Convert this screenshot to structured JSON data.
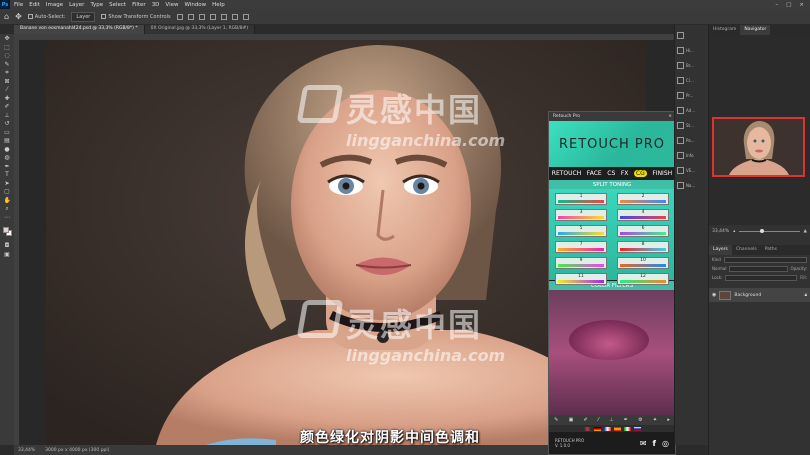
{
  "menubar": {
    "logo": "Ps",
    "items": [
      "File",
      "Edit",
      "Image",
      "Layer",
      "Type",
      "Select",
      "Filter",
      "3D",
      "View",
      "Window",
      "Help"
    ],
    "window_controls": [
      "–",
      "□",
      "×"
    ]
  },
  "options_bar": {
    "auto_select": "Auto-Select:",
    "layer_select": "Layer",
    "transform_controls": "Show Transform Controls"
  },
  "tabs": [
    {
      "label": "Banane von eosmanahl424.psd @ 33,3% (RGB/8*) *",
      "active": true
    },
    {
      "label": "0X Original.jpg @ 33,3% (Layer 1, RGB/8#)",
      "active": false
    }
  ],
  "status": {
    "zoom": "33,44%",
    "doc": "3000 px x 4000 px (300 ppi)"
  },
  "subtitle": "颜色绿化对阴影中间色调和",
  "watermark": {
    "cn": "灵感中国",
    "en": "lingganchina.com"
  },
  "retouch_pro": {
    "window_title": "Retouch Pro",
    "close": "×",
    "logo": "RETOUCH PRO",
    "nav": [
      "RETOUCH",
      "FACE",
      "CS",
      "FX",
      "CG",
      "FINISH"
    ],
    "nav_active": "CG",
    "split_toning": "SPLIT TONING",
    "cells": [
      "1",
      "2",
      "3",
      "4",
      "5",
      "6",
      "7",
      "8",
      "9",
      "10",
      "11",
      "12"
    ],
    "color_filters": "COLOR FILTERS",
    "footer_name": "RETOUCH PRO",
    "footer_version": "V. 1.0.0"
  },
  "mini_dock": [
    {
      "label": "",
      "icon": "play-icon"
    },
    {
      "label": "Hi...",
      "icon": "history-icon"
    },
    {
      "label": "Br...",
      "icon": "brush-icon"
    },
    {
      "label": "Cl...",
      "icon": "clone-icon"
    },
    {
      "label": "Pr...",
      "icon": "properties-icon"
    },
    {
      "label": "Ad...",
      "icon": "adjust-icon"
    },
    {
      "label": "St...",
      "icon": "styles-icon"
    },
    {
      "label": "Pa...",
      "icon": "paths-icon"
    },
    {
      "label": "Info",
      "icon": "info-icon"
    },
    {
      "label": "VE...",
      "icon": "ve-icon"
    },
    {
      "label": "Na...",
      "icon": "navigator-icon"
    }
  ],
  "right_panel": {
    "tabs": [
      "Histogram",
      "Navigator"
    ],
    "active_tab": "Navigator",
    "zoom": "33,44%",
    "layer_tabs": [
      "Layers",
      "Channels",
      "Paths"
    ],
    "layer_name": "Background",
    "kind": "Kind",
    "normal": "Normal",
    "opacity": "Opacity:",
    "lock": "Lock:",
    "fill": "Fill:"
  },
  "colors": {
    "panel_teal": "#39d7bd",
    "nav_active": "#f2e000",
    "photoshop_bg": "#2b2b2b"
  }
}
